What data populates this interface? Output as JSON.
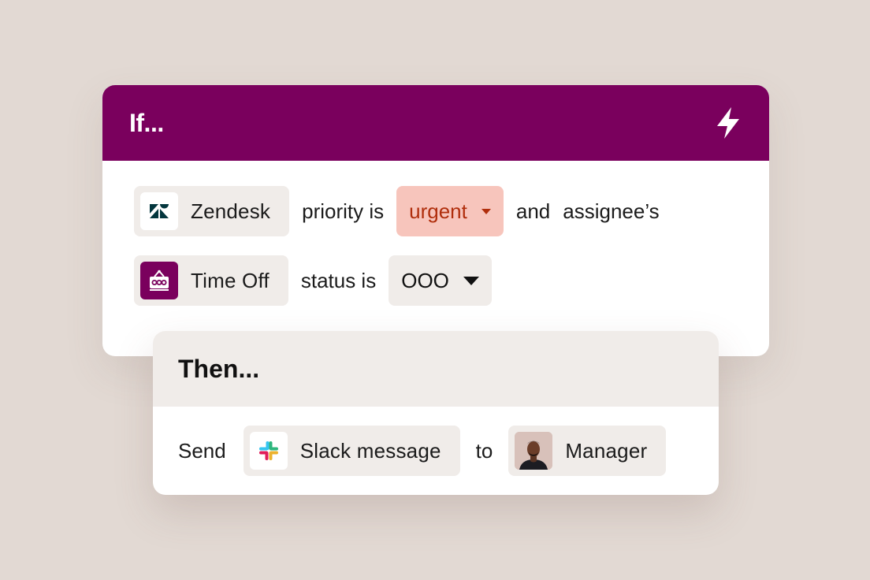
{
  "colors": {
    "background": "#e2d9d3",
    "if_header": "#7a005d",
    "chip_bg": "#f0ece9",
    "urgent_bg": "#f7c5bc",
    "urgent_text": "#b02e0c"
  },
  "if_card": {
    "title": "If...",
    "trigger_icon": "lightning-bolt-icon",
    "row1": {
      "app_icon": "zendesk-icon",
      "app_label": "Zendesk",
      "text1": "priority is",
      "value": "urgent",
      "text2": "and",
      "text3": "assignee’s"
    },
    "row2": {
      "app_icon": "time-off-icon",
      "app_label": "Time Off",
      "text1": "status is",
      "value": "OOO"
    }
  },
  "then_card": {
    "title": "Then...",
    "action": "Send",
    "app_icon": "slack-icon",
    "app_label": "Slack message",
    "connector": "to",
    "recipient_icon": "avatar",
    "recipient_label": "Manager"
  }
}
